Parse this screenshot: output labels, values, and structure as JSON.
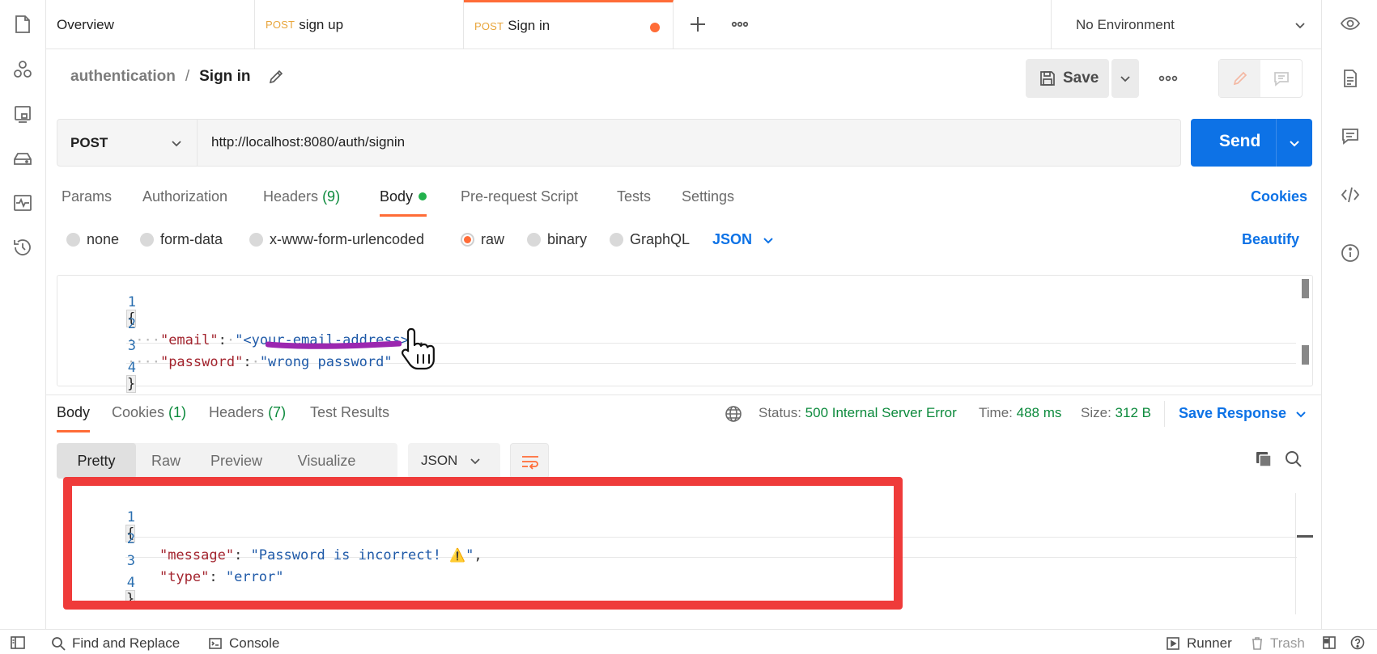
{
  "tabs": [
    {
      "method": "",
      "label": "Overview"
    },
    {
      "method": "POST",
      "label": "sign up"
    },
    {
      "method": "POST",
      "label": "Sign in"
    }
  ],
  "environment": "No Environment",
  "breadcrumb": {
    "collection": "authentication",
    "separator": "/",
    "request": "Sign in"
  },
  "toolbar": {
    "save_label": "Save"
  },
  "request": {
    "method": "POST",
    "url": "http://localhost:8080/auth/signin",
    "send_label": "Send"
  },
  "request_tabs": [
    {
      "label": "Params",
      "count": ""
    },
    {
      "label": "Authorization",
      "count": ""
    },
    {
      "label": "Headers",
      "count": "(9)"
    },
    {
      "label": "Body",
      "count": ""
    },
    {
      "label": "Pre-request Script",
      "count": ""
    },
    {
      "label": "Tests",
      "count": ""
    },
    {
      "label": "Settings",
      "count": ""
    }
  ],
  "cookies_link": "Cookies",
  "body_types": [
    "none",
    "form-data",
    "x-www-form-urlencoded",
    "raw",
    "binary",
    "GraphQL"
  ],
  "body_format": "JSON",
  "beautify": "Beautify",
  "request_body": {
    "lines": [
      "1",
      "2",
      "3",
      "4"
    ],
    "open": "{",
    "close": "}",
    "email_key": "\"email\"",
    "email_value": "\"<your-email-address>\"",
    "password_key": "\"password\"",
    "password_value": "\"wrong password\""
  },
  "response_tabs": [
    {
      "label": "Body",
      "count": ""
    },
    {
      "label": "Cookies",
      "count": "(1)"
    },
    {
      "label": "Headers",
      "count": "(7)"
    },
    {
      "label": "Test Results",
      "count": ""
    }
  ],
  "response_meta": {
    "status_label": "Status:",
    "status_value": "500 Internal Server Error",
    "time_label": "Time:",
    "time_value": "488 ms",
    "size_label": "Size:",
    "size_value": "312 B"
  },
  "save_response": "Save Response",
  "view_modes": [
    "Pretty",
    "Raw",
    "Preview",
    "Visualize"
  ],
  "response_format": "JSON",
  "response_body": {
    "lines": [
      "1",
      "2",
      "3",
      "4"
    ],
    "open": "{",
    "close": "}",
    "message_key": "\"message\"",
    "message_value": "\"Password is incorrect! ",
    "message_emoji": "⚠️",
    "message_end": "\"",
    "type_key": "\"type\"",
    "type_value": "\"error\""
  },
  "footer": {
    "find_replace": "Find and Replace",
    "console": "Console",
    "runner": "Runner",
    "trash": "Trash"
  },
  "colors": {
    "accent": "#ff6c37",
    "primary": "#0d72e6",
    "success": "#0c8a3c",
    "highlight_box": "#ef3b3a",
    "annotation": "#9b27b0"
  }
}
